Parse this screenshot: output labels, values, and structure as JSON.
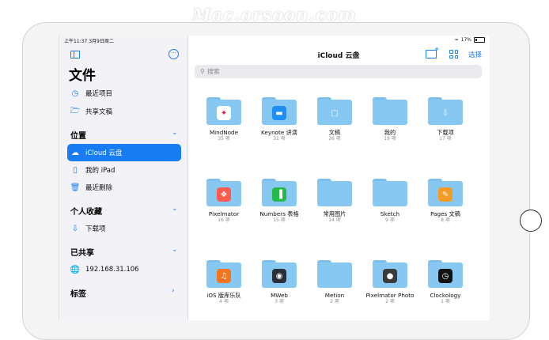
{
  "watermark": "Mac.orsoon.com",
  "status": {
    "time": "上午11:37  3月9日周二",
    "battery": "17%"
  },
  "sidebar": {
    "title": "文件",
    "top_items": [
      {
        "label": "最近项目",
        "icon": "clock-icon"
      },
      {
        "label": "共享文稿",
        "icon": "shared-folder-icon"
      }
    ],
    "locations_header": "位置",
    "locations": [
      {
        "label": "iCloud 云盘",
        "icon": "cloud-icon",
        "active": true
      },
      {
        "label": "我的 iPad",
        "icon": "ipad-icon"
      },
      {
        "label": "最近删除",
        "icon": "trash-icon"
      }
    ],
    "favorites_header": "个人收藏",
    "favorites": [
      {
        "label": "下载项",
        "icon": "download-icon"
      }
    ],
    "shared_header": "已共享",
    "shared": [
      {
        "label": "192.168.31.106",
        "icon": "globe-icon"
      }
    ],
    "tags_header": "标签"
  },
  "main": {
    "title": "iCloud 云盘",
    "select_label": "选择",
    "search_placeholder": "搜索",
    "rows": [
      [
        {
          "name": "MindNode",
          "count": "35 项",
          "icon": "mindnode-icon",
          "color": "#ffffff"
        },
        {
          "name": "Keynote 讲演",
          "count": "31 项",
          "icon": "keynote-icon",
          "color": "#1e8ef5"
        },
        {
          "name": "文稿",
          "count": "26 项",
          "icon": "document-icon",
          "color": ""
        },
        {
          "name": "我的",
          "count": "19 项",
          "icon": "",
          "color": ""
        },
        {
          "name": "下载项",
          "count": "17 项",
          "icon": "download-icon",
          "color": ""
        }
      ],
      [
        {
          "name": "Pixelmator",
          "count": "16 项",
          "icon": "pixelmator-icon",
          "color": "#ff5b4e"
        },
        {
          "name": "Numbers 表格",
          "count": "15 项",
          "icon": "numbers-icon",
          "color": "#27b84a"
        },
        {
          "name": "常用图片",
          "count": "14 项",
          "icon": "",
          "color": ""
        },
        {
          "name": "Sketch",
          "count": "9 项",
          "icon": "",
          "color": ""
        },
        {
          "name": "Pages 文稿",
          "count": "8 项",
          "icon": "pages-icon",
          "color": "#f59a23"
        }
      ],
      [
        {
          "name": "iOS 版库乐队",
          "count": "4 项",
          "icon": "garageband-icon",
          "color": "#f5751e"
        },
        {
          "name": "MWeb",
          "count": "3 项",
          "icon": "mweb-icon",
          "color": "#2a2e38"
        },
        {
          "name": "Metion",
          "count": "2 项",
          "icon": "",
          "color": ""
        },
        {
          "name": "Pixelmator Photo",
          "count": "2 项",
          "icon": "pixelmator-photo-icon",
          "color": "#3a3a3a"
        },
        {
          "name": "Clockology",
          "count": "1 项",
          "icon": "clockology-icon",
          "color": "#111111"
        }
      ]
    ]
  }
}
